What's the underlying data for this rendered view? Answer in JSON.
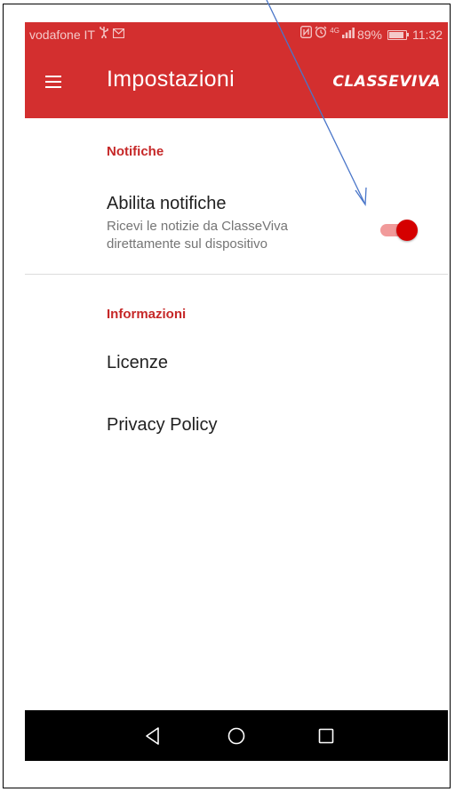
{
  "status_bar": {
    "carrier": "vodafone IT",
    "carrier_icons": [
      "usb-icon",
      "mail-icon"
    ],
    "right_icons": [
      "nfc-icon",
      "alarm-icon",
      "network-4g-icon",
      "signal-icon"
    ],
    "network_label": "4G",
    "battery_percent": "89%",
    "time": "11:32"
  },
  "app_bar": {
    "title": "Impostazioni",
    "brand": "CLASSEVIVA",
    "menu_icon": "hamburger-menu-icon"
  },
  "sections": [
    {
      "title": "Notifiche",
      "items": [
        {
          "title": "Abilita notifiche",
          "summary": "Ricevi le notizie da ClasseViva direttamente sul dispositivo",
          "toggle": true
        }
      ]
    },
    {
      "title": "Informazioni",
      "items": [
        {
          "title": "Licenze"
        },
        {
          "title": "Privacy Policy"
        }
      ]
    }
  ],
  "nav_bar": {
    "buttons": [
      "back-triangle-icon",
      "home-circle-icon",
      "recents-square-icon"
    ]
  },
  "colors": {
    "primary": "#d32f2f",
    "accent": "#d50000",
    "section_title": "#c62828",
    "arrow": "#4a76c9"
  }
}
